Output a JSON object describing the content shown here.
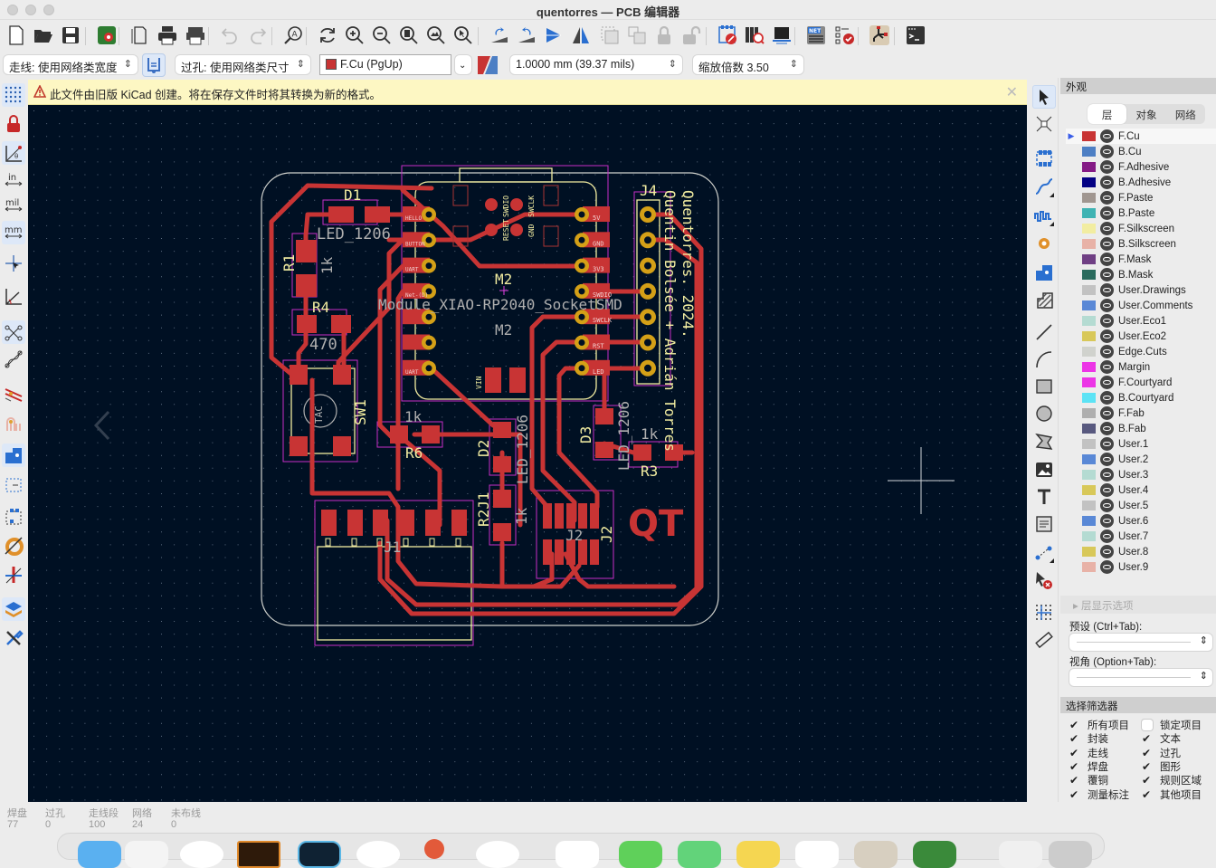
{
  "window": {
    "title": "quentorres — PCB 编辑器"
  },
  "toolbar": {
    "icons": [
      "new-board",
      "open",
      "save",
      "board-setup",
      "page-settings",
      "print",
      "plot",
      "undo",
      "redo",
      "find",
      "redraw",
      "zoom-in",
      "zoom-out",
      "zoom-fit",
      "zoom-objects",
      "zoom-selection",
      "rotate-ccw",
      "rotate-cw",
      "flip",
      "mirror",
      "group",
      "ungroup",
      "lock",
      "unlock",
      "footprint-editor",
      "footprint-browser",
      "3d-viewer",
      "netlist",
      "drc",
      "schematic",
      "scripting-console"
    ]
  },
  "toolbar2": {
    "track_width": "走线: 使用网络类宽度",
    "via_size": "过孔: 使用网络类尺寸",
    "active_layer": "F.Cu (PgUp)",
    "active_layer_color": "#c83434",
    "grid": "1.0000 mm (39.37 mils)",
    "zoom": "缩放倍数 3.50"
  },
  "infobar": {
    "message": "此文件由旧版 KiCad 创建。将在保存文件时将其转换为新的格式。"
  },
  "left_toolbar": [
    "grid-dots",
    "lock-ratsnest",
    "polar-coords",
    "inch-units",
    "mil-units",
    "mm-units",
    "full-crosshair",
    "angle-snap",
    "ratsnest",
    "curved-ratsnest",
    "track-highlight",
    "track-clearance",
    "footprint-courtyard",
    "via-zone",
    "zone-outline",
    "fill-zone",
    "high-contrast",
    "layers-manager",
    "tools"
  ],
  "left_toolbar_labels": {
    "in": "in",
    "mil": "mil",
    "mm": "mm"
  },
  "right_toolbar": [
    "select",
    "local-ratsnest",
    "add-footprint",
    "route-track",
    "tune-length",
    "add-via",
    "add-zone",
    "rule-area",
    "draw-line",
    "draw-arc",
    "draw-rectangle",
    "draw-circle",
    "draw-polygon",
    "add-image",
    "add-text",
    "add-textbox",
    "add-dimension",
    "delete",
    "grid-origin",
    "measure"
  ],
  "panel": {
    "title": "外观",
    "tabs": [
      {
        "label": "层",
        "active": true
      },
      {
        "label": "对象",
        "active": false
      },
      {
        "label": "网络",
        "active": false
      }
    ],
    "layers": [
      {
        "name": "F.Cu",
        "color": "#c83434",
        "active": true
      },
      {
        "name": "B.Cu",
        "color": "#4d7fc4"
      },
      {
        "name": "F.Adhesive",
        "color": "#841a85"
      },
      {
        "name": "B.Adhesive",
        "color": "#030083"
      },
      {
        "name": "F.Paste",
        "color": "#a09690"
      },
      {
        "name": "B.Paste",
        "color": "#3fb3b3"
      },
      {
        "name": "F.Silkscreen",
        "color": "#f2eda1"
      },
      {
        "name": "B.Silkscreen",
        "color": "#e8b2a7"
      },
      {
        "name": "F.Mask",
        "color": "#6f3f84"
      },
      {
        "name": "B.Mask",
        "color": "#2a6b5d"
      },
      {
        "name": "User.Drawings",
        "color": "#c2c2c2"
      },
      {
        "name": "User.Comments",
        "color": "#5988d6"
      },
      {
        "name": "User.Eco1",
        "color": "#b4dbd2"
      },
      {
        "name": "User.Eco2",
        "color": "#d8c859"
      },
      {
        "name": "Edge.Cuts",
        "color": "#d0d2cd"
      },
      {
        "name": "Margin",
        "color": "#ec35e6"
      },
      {
        "name": "F.Courtyard",
        "color": "#ec35e6"
      },
      {
        "name": "B.Courtyard",
        "color": "#5ce3f5"
      },
      {
        "name": "F.Fab",
        "color": "#afafaf"
      },
      {
        "name": "B.Fab",
        "color": "#58597f"
      },
      {
        "name": "User.1",
        "color": "#c2c2c2"
      },
      {
        "name": "User.2",
        "color": "#5988d6"
      },
      {
        "name": "User.3",
        "color": "#b4dbd2"
      },
      {
        "name": "User.4",
        "color": "#d8c859"
      },
      {
        "name": "User.5",
        "color": "#c2c2c2"
      },
      {
        "name": "User.6",
        "color": "#5988d6"
      },
      {
        "name": "User.7",
        "color": "#b4dbd2"
      },
      {
        "name": "User.8",
        "color": "#d8c859"
      },
      {
        "name": "User.9",
        "color": "#e8b2a7"
      }
    ],
    "layer_options": "层显示选项",
    "preset_label": "预设 (Ctrl+Tab):",
    "preset_value": "",
    "viewport_label": "视角 (Option+Tab):",
    "viewport_value": "",
    "filter_title": "选择筛选器",
    "filters": [
      {
        "label": "所有项目",
        "checked": true
      },
      {
        "label": "锁定项目",
        "checked": false
      },
      {
        "label": "封装",
        "checked": true
      },
      {
        "label": "文本",
        "checked": true
      },
      {
        "label": "走线",
        "checked": true
      },
      {
        "label": "过孔",
        "checked": true
      },
      {
        "label": "焊盘",
        "checked": true
      },
      {
        "label": "图形",
        "checked": true
      },
      {
        "label": "覆铜",
        "checked": true
      },
      {
        "label": "规则区域",
        "checked": true
      },
      {
        "label": "测量标注",
        "checked": true
      },
      {
        "label": "其他项目",
        "checked": true
      }
    ]
  },
  "status": [
    {
      "label": "焊盘",
      "value": "77"
    },
    {
      "label": "过孔",
      "value": "0"
    },
    {
      "label": "走线段",
      "value": "100"
    },
    {
      "label": "网络",
      "value": "24"
    },
    {
      "label": "未布线",
      "value": "0"
    }
  ],
  "pcb": {
    "colors": {
      "background": "#001023",
      "copper": "#c83434",
      "silk": "#f2eda1",
      "edge": "#d0d2cd",
      "courtyard": "#c72ec7",
      "fab": "#afafaf",
      "pad_ring": "#d4a017"
    },
    "labels": {
      "D1": "D1",
      "D1_val": "LED_1206",
      "R1": "R1",
      "R1_val": "1k",
      "R4": "R4",
      "R4_val": "470",
      "SW1": "SW1",
      "SW1_fab": "TAC",
      "M2": "M2",
      "M2_fab": "M2",
      "M2_val": "Module_XIAO-RP2040_SocketSMD",
      "J4": "J4",
      "R6": "R6",
      "R6_val": "1k",
      "D2": "D2",
      "D2_val": "LED_1206",
      "R2": "R2",
      "R2_val": "1k",
      "R2_ref_fab": "R2J1",
      "D3": "D3",
      "D3_val": "LED_1206",
      "R3": "R3",
      "R3_val": "1k",
      "J1": "J1",
      "J2": "J2",
      "credit1": "Quentorres. 2024.",
      "credit2": "Quentin Bolsée + Adrián Torres",
      "logo": "QT",
      "swd": [
        "RESET",
        "SWDIO",
        "GND",
        "SWCLK"
      ],
      "pads_left": [
        "HELLO",
        "BUTTON",
        "UART",
        "Net-(D)",
        "",
        "",
        "UART"
      ],
      "pads_right": [
        "5V",
        "GND",
        "3V3",
        "SWDIO",
        "SWCLK",
        "RST",
        "LED"
      ],
      "vin": "VIN",
      "gnd": "GND"
    }
  }
}
